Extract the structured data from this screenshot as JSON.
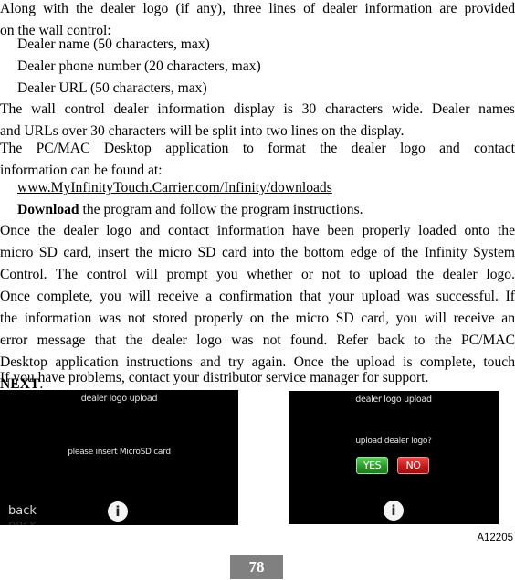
{
  "paragraphs": {
    "intro_line1": "Along with the dealer logo (if any), three lines of dealer information are provided",
    "intro_line2": "on the wall control:",
    "list": [
      "Dealer name (50 characters, max)",
      "Dealer phone number (20 characters, max)",
      "Dealer URL (50 characters, max)"
    ],
    "display_line1": "The wall control dealer information display is 30 characters wide. Dealer names",
    "display_line2": "and URLs over 30 characters will be split into two lines on the display.",
    "app_line1": "The PC/MAC Desktop application to format the dealer logo and contact",
    "app_line2": "information can be found at:",
    "download_url": "www.MyInfinityTouch.Carrier.com/Infinity/downloads",
    "download_bold": "Download",
    "download_rest": " the program and follow the program instructions.",
    "once_lines": [
      "Once the dealer logo and contact information have been properly loaded onto the",
      "micro SD card, insert the micro SD card into the bottom edge of the Infinity System",
      "Control. The control will prompt you whether or not to upload the dealer logo.",
      "Once complete, you will receive a confirmation that your upload was successful. If",
      "the information was not stored properly on the micro SD card, you will receive an",
      "error message that the dealer logo was not found. Refer back to the PC/MAC",
      "Desktop application instructions and try again. Once the upload is complete, touch"
    ],
    "once_last_bold": "NEXT",
    "once_last_rest": ".",
    "support": "If you have problems, contact your distributor service manager for support."
  },
  "screen1": {
    "title": "dealer logo upload",
    "message": "please insert MicroSD card",
    "back_label": "back",
    "info_glyph": "i",
    "info_icon": "info-icon"
  },
  "screen2": {
    "title": "dealer logo upload",
    "message": "upload dealer logo?",
    "yes_label": "YES",
    "no_label": "NO",
    "info_glyph": "i",
    "info_icon": "info-icon",
    "colors": {
      "yes": "#2f9a2f",
      "no": "#c21b1b"
    }
  },
  "figure_id": "A12205",
  "page_number": "78"
}
